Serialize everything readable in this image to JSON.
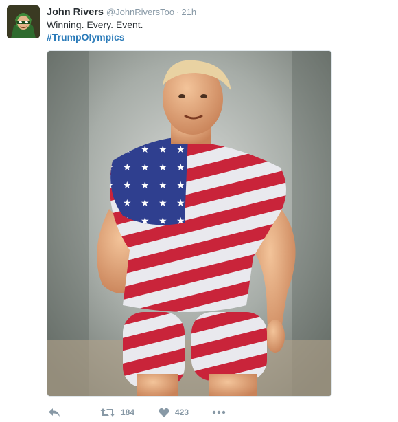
{
  "tweet": {
    "author_name": "John Rivers",
    "author_handle": "@JohnRiversToo",
    "separator": "·",
    "timestamp": "21h",
    "text": "Winning. Every. Event.",
    "hashtag": "#TrumpOlympics",
    "media_alt": "photo of a muscular runner wearing a stars-and-stripes shirt and shorts"
  },
  "actions": {
    "reply_icon": "reply-icon",
    "retweet_icon": "retweet-icon",
    "retweet_count": "184",
    "like_icon": "heart-icon",
    "like_count": "423",
    "more_icon": "more-icon"
  },
  "colors": {
    "name": "#292f33",
    "muted": "#8899a6",
    "link": "#2b7bb9",
    "flag_red": "#b22234",
    "flag_blue": "#3c3b6e"
  }
}
